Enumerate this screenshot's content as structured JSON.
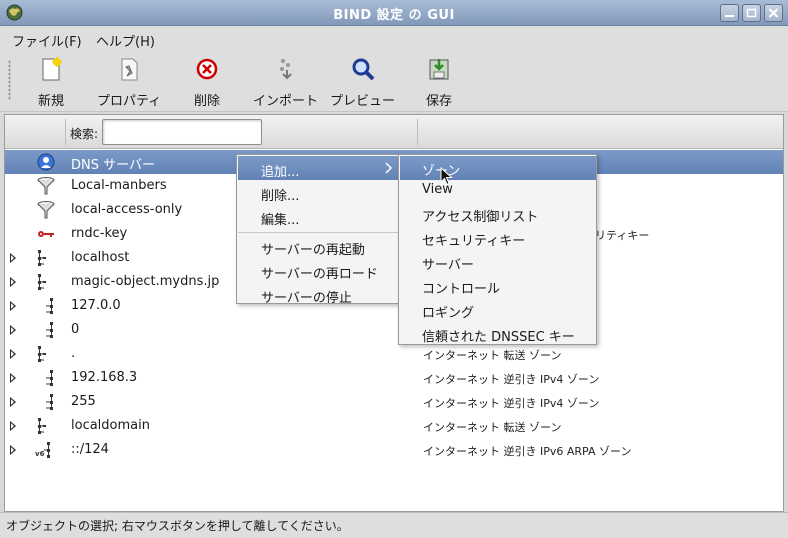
{
  "window": {
    "title": "BIND 設定 の GUI"
  },
  "menubar": {
    "file": "ファイル(F)",
    "help": "ヘルプ(H)"
  },
  "toolbar": {
    "new": "新規",
    "properties": "プロパティ",
    "delete": "削除",
    "import": "インポート",
    "preview": "プレビュー",
    "save": "保存"
  },
  "search": {
    "label": "検索:",
    "value": ""
  },
  "tree": [
    {
      "name": "DNS サーバー",
      "desc": "",
      "icon": "dns-server-icon"
    },
    {
      "name": "Local-manbers",
      "desc": "",
      "icon": "funnel-icon"
    },
    {
      "name": "local-access-only",
      "desc": "",
      "icon": "funnel-icon"
    },
    {
      "name": "rndc-key",
      "desc": "リティキー",
      "icon": "key-icon"
    },
    {
      "name": "localhost",
      "desc": "",
      "icon": "zone-tree-icon"
    },
    {
      "name": "magic-object.mydns.jp",
      "desc": "",
      "icon": "zone-tree-icon"
    },
    {
      "name": "127.0.0",
      "desc": "",
      "icon": "reverse-zone-icon"
    },
    {
      "name": "0",
      "desc": "",
      "icon": "reverse-zone-icon"
    },
    {
      "name": ".",
      "desc": "インターネット 転送 ゾーン",
      "icon": "zone-tree-icon"
    },
    {
      "name": "192.168.3",
      "desc": "インターネット 逆引き IPv4 ゾーン",
      "icon": "reverse-zone-icon"
    },
    {
      "name": "255",
      "desc": "インターネット 逆引き IPv4 ゾーン",
      "icon": "reverse-zone-icon"
    },
    {
      "name": "localdomain",
      "desc": "インターネット 転送 ゾーン",
      "icon": "zone-tree-icon"
    },
    {
      "name": "::/124",
      "desc": "インターネット 逆引き IPv6 ARPA ゾーン",
      "icon": "ipv6-zone-icon"
    }
  ],
  "context_menu": {
    "add": "追加...",
    "delete": "削除...",
    "edit": "編集...",
    "restart": "サーバーの再起動",
    "reload": "サーバーの再ロード",
    "stop": "サーバーの停止"
  },
  "submenu": {
    "zone": "ゾーン",
    "view": "View",
    "acl": "アクセス制御リスト",
    "key": "セキュリティキー",
    "server": "サーバー",
    "control": "コントロール",
    "logging": "ロギング",
    "trusted": "信頼された DNSSEC キー"
  },
  "status": {
    "text": "オブジェクトの選択; 右マウスボタンを押して離してください。"
  },
  "colors": {
    "selection": "#6f8fc0",
    "titlebar": "#95a9c7"
  }
}
